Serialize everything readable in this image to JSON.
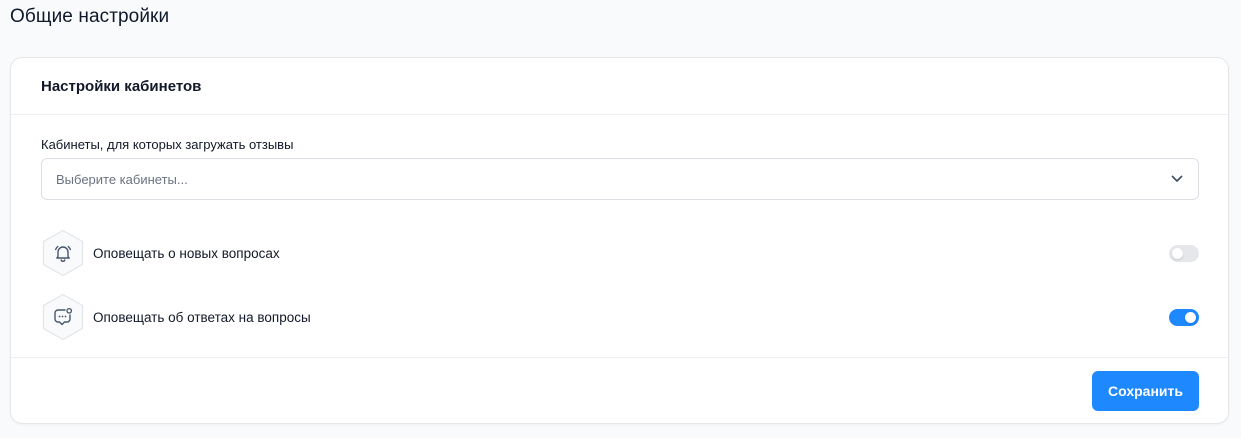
{
  "page": {
    "title": "Общие настройки"
  },
  "card": {
    "title": "Настройки кабинетов",
    "cabinets_field": {
      "label": "Кабинеты, для которых загружать отзывы",
      "placeholder": "Выберите кабинеты...",
      "icon": "chevron-down-icon"
    },
    "toggles": [
      {
        "label": "Оповещать о новых вопросах",
        "icon": "bell-icon",
        "enabled": false
      },
      {
        "label": "Оповещать об ответах на вопросы",
        "icon": "chat-notification-icon",
        "enabled": true
      }
    ],
    "save_label": "Сохранить"
  },
  "colors": {
    "accent": "#1e88ff",
    "toggle_off": "#e5e7eb",
    "border": "#e5e7eb"
  }
}
